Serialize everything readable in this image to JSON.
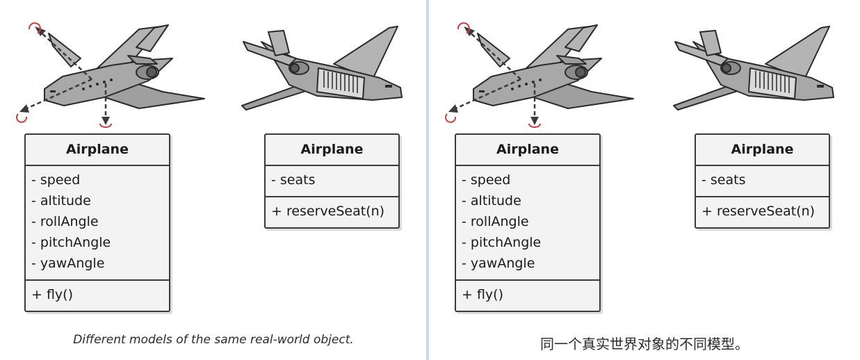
{
  "left": {
    "class_a": {
      "name": "Airplane",
      "fields": [
        "- speed",
        "- altitude",
        "- rollAngle",
        "- pitchAngle",
        "- yawAngle"
      ],
      "methods": [
        "+ fly()"
      ]
    },
    "class_b": {
      "name": "Airplane",
      "fields": [
        "- seats"
      ],
      "methods": [
        "+ reserveSeat(n)"
      ]
    },
    "caption": "Different models of the same real-world object."
  },
  "right": {
    "class_a": {
      "name": "Airplane",
      "fields": [
        "- speed",
        "- altitude",
        "- rollAngle",
        "- pitchAngle",
        "- yawAngle"
      ],
      "methods": [
        "+ fly()"
      ]
    },
    "class_b": {
      "name": "Airplane",
      "fields": [
        "- seats"
      ],
      "methods": [
        "+ reserveSeat(n)"
      ]
    },
    "caption": "同一个真实世界对象的不同模型。"
  },
  "icons": [
    "airplane-flight-axes-icon",
    "airplane-cabin-cutaway-icon",
    "rotation-arrow-icon"
  ],
  "colors": {
    "box_fill": "#f3f3f3",
    "box_border": "#3a3a3a",
    "plane_body": "#a8a8a8",
    "rotation_arrow": "#d33a3a",
    "divider": "#c9dcef"
  }
}
